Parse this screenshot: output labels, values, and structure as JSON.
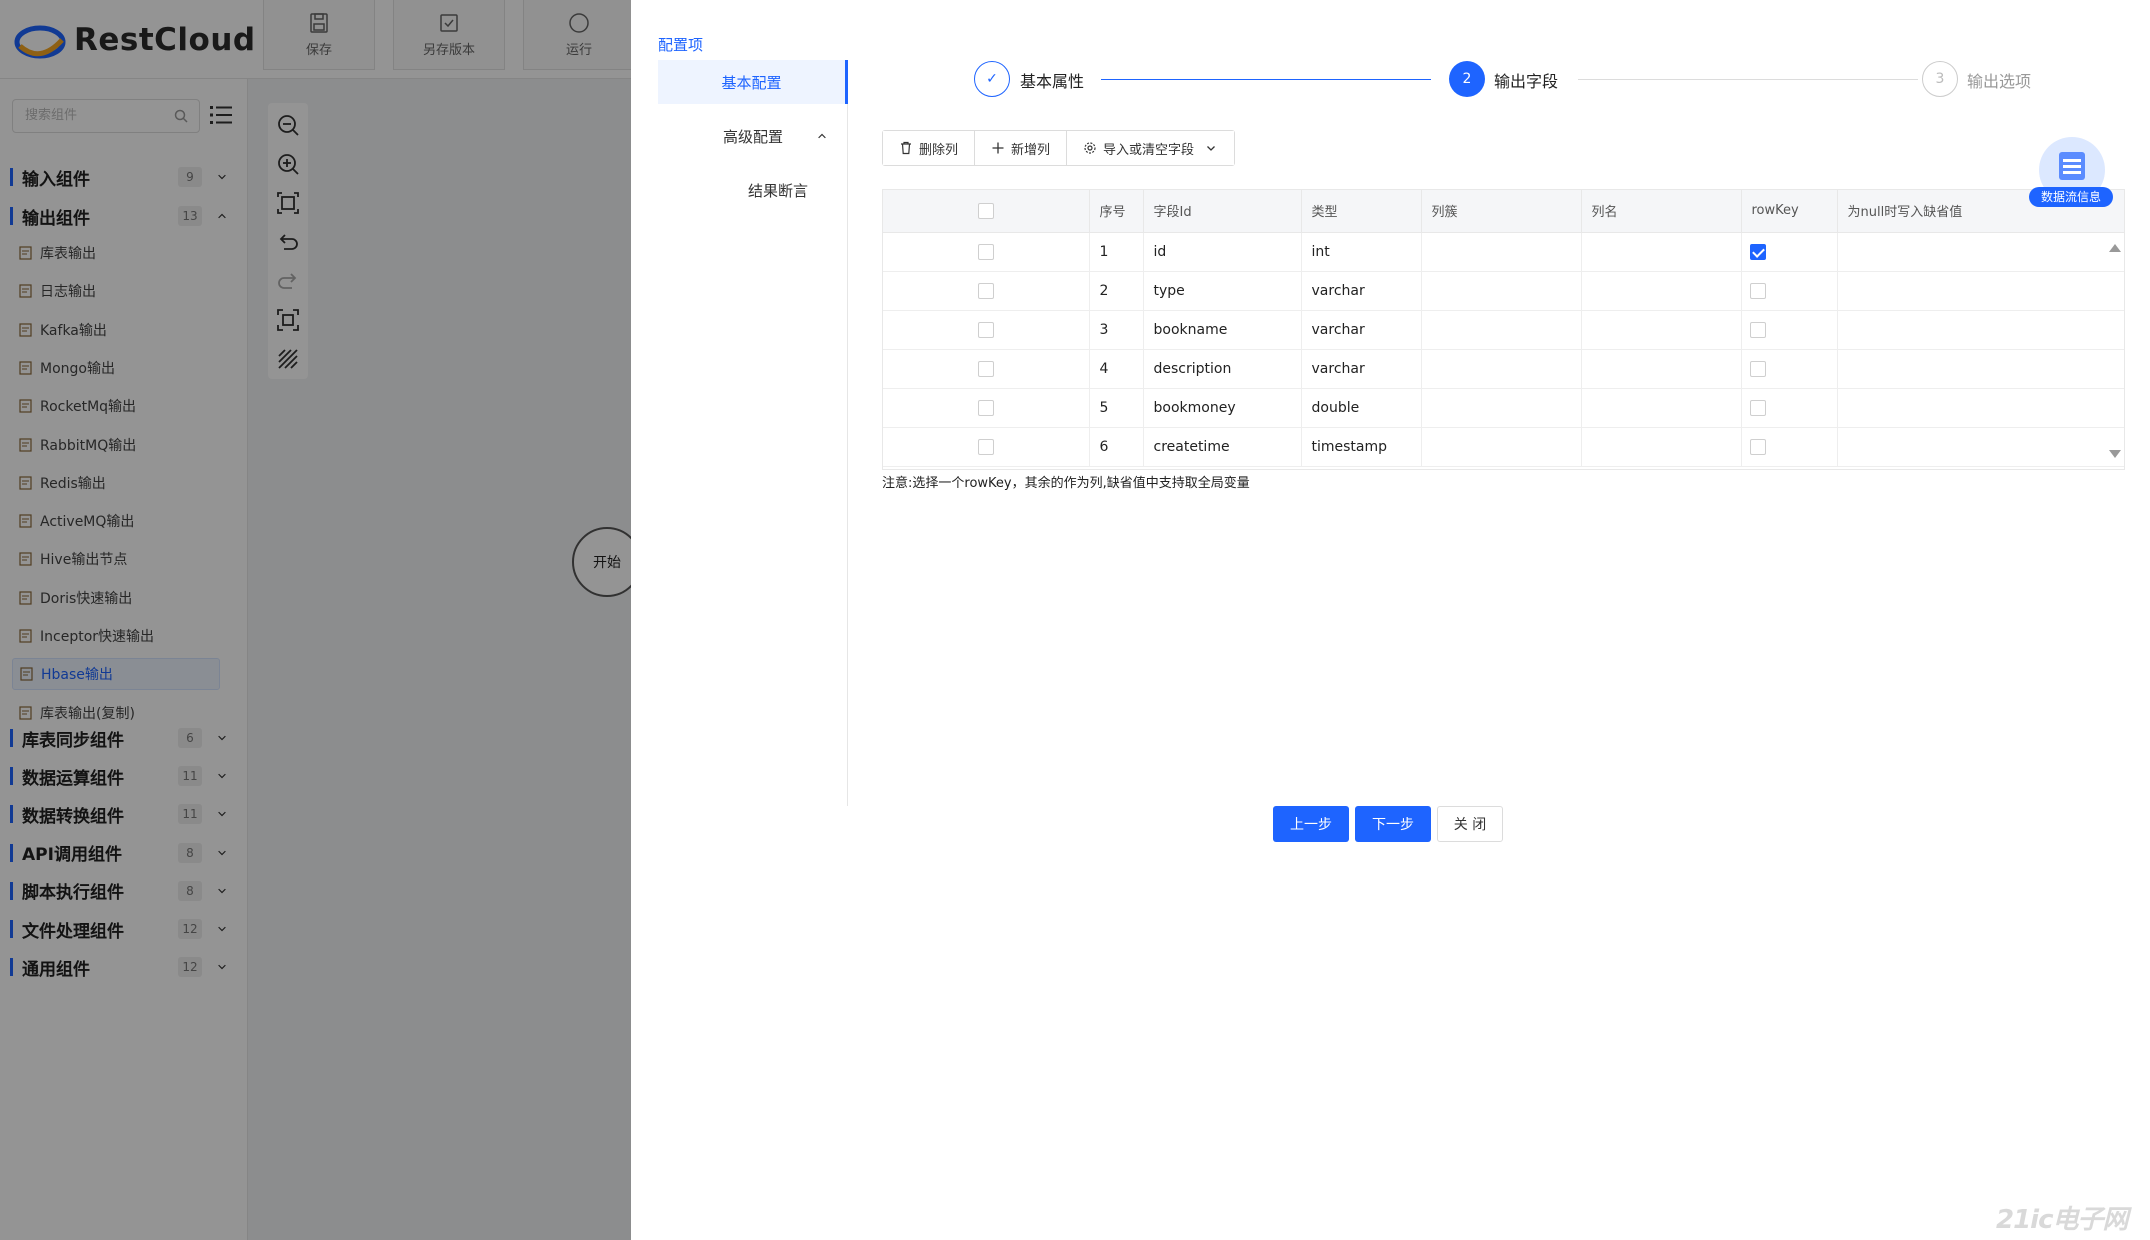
{
  "app": {
    "logo_text": "RestCloud",
    "toolbar": [
      {
        "label": "保存",
        "icon": "save-icon"
      },
      {
        "label": "另存版本",
        "icon": "save-version-icon"
      },
      {
        "label": "运行",
        "icon": "run-icon"
      }
    ]
  },
  "sidebar": {
    "search_placeholder": "搜索组件",
    "groups_top": [
      {
        "title": "输入组件",
        "count": "9",
        "expanded": false
      },
      {
        "title": "输出组件",
        "count": "13",
        "expanded": true
      }
    ],
    "components": [
      {
        "label": "库表输出",
        "active": false
      },
      {
        "label": "日志输出",
        "active": false
      },
      {
        "label": "Kafka输出",
        "active": false
      },
      {
        "label": "Mongo输出",
        "active": false
      },
      {
        "label": "RocketMq输出",
        "active": false
      },
      {
        "label": "RabbitMQ输出",
        "active": false
      },
      {
        "label": "Redis输出",
        "active": false
      },
      {
        "label": "ActiveMQ输出",
        "active": false
      },
      {
        "label": "Hive输出节点",
        "active": false
      },
      {
        "label": "Doris快速输出",
        "active": false
      },
      {
        "label": "Inceptor快速输出",
        "active": false
      },
      {
        "label": "Hbase输出",
        "active": true
      },
      {
        "label": "库表输出(复制)",
        "active": false
      }
    ],
    "groups_bottom": [
      {
        "title": "库表同步组件",
        "count": "6"
      },
      {
        "title": "数据运算组件",
        "count": "11"
      },
      {
        "title": "数据转换组件",
        "count": "11"
      },
      {
        "title": "API调用组件",
        "count": "8"
      },
      {
        "title": "脚本执行组件",
        "count": "8"
      },
      {
        "title": "文件处理组件",
        "count": "12"
      },
      {
        "title": "通用组件",
        "count": "12"
      }
    ]
  },
  "canvas": {
    "start_node_label": "开始"
  },
  "drawer": {
    "section_title": "配置项",
    "menu": [
      {
        "label": "基本配置",
        "active": true
      },
      {
        "label": "高级配置",
        "active": false
      },
      {
        "label": "结果断言",
        "active": false
      }
    ],
    "steps": [
      {
        "label": "基本属性",
        "marker": "✓",
        "state": "done"
      },
      {
        "label": "输出字段",
        "marker": "2",
        "state": "current"
      },
      {
        "label": "输出选项",
        "marker": "3",
        "state": "pending"
      }
    ],
    "toolbar": {
      "delete_label": "删除列",
      "add_label": "新增列",
      "import_label": "导入或清空字段"
    },
    "table": {
      "columns": [
        "",
        "序号",
        "字段Id",
        "类型",
        "列簇",
        "列名",
        "rowKey",
        "为null时写入缺省值"
      ],
      "rows": [
        {
          "no": "1",
          "field": "id",
          "type": "int",
          "family": "",
          "column": "",
          "rowkey": true,
          "default": ""
        },
        {
          "no": "2",
          "field": "type",
          "type": "varchar",
          "family": "",
          "column": "",
          "rowkey": false,
          "default": ""
        },
        {
          "no": "3",
          "field": "bookname",
          "type": "varchar",
          "family": "",
          "column": "",
          "rowkey": false,
          "default": ""
        },
        {
          "no": "4",
          "field": "description",
          "type": "varchar",
          "family": "",
          "column": "",
          "rowkey": false,
          "default": ""
        },
        {
          "no": "5",
          "field": "bookmoney",
          "type": "double",
          "family": "",
          "column": "",
          "rowkey": false,
          "default": ""
        },
        {
          "no": "6",
          "field": "createtime",
          "type": "timestamp",
          "family": "",
          "column": "",
          "rowkey": false,
          "default": ""
        }
      ]
    },
    "note": "注意:选择一个rowKey，其余的作为列,缺省值中支持取全局变量",
    "flow_badge_label": "数据流信息",
    "buttons": {
      "prev": "上一步",
      "next": "下一步",
      "close": "关 闭"
    }
  },
  "watermark": {
    "main": "21ic",
    "sub": "电子网"
  },
  "colors": {
    "accent": "#1e64ff",
    "overlay": "rgba(0,0,0,0.42)"
  }
}
